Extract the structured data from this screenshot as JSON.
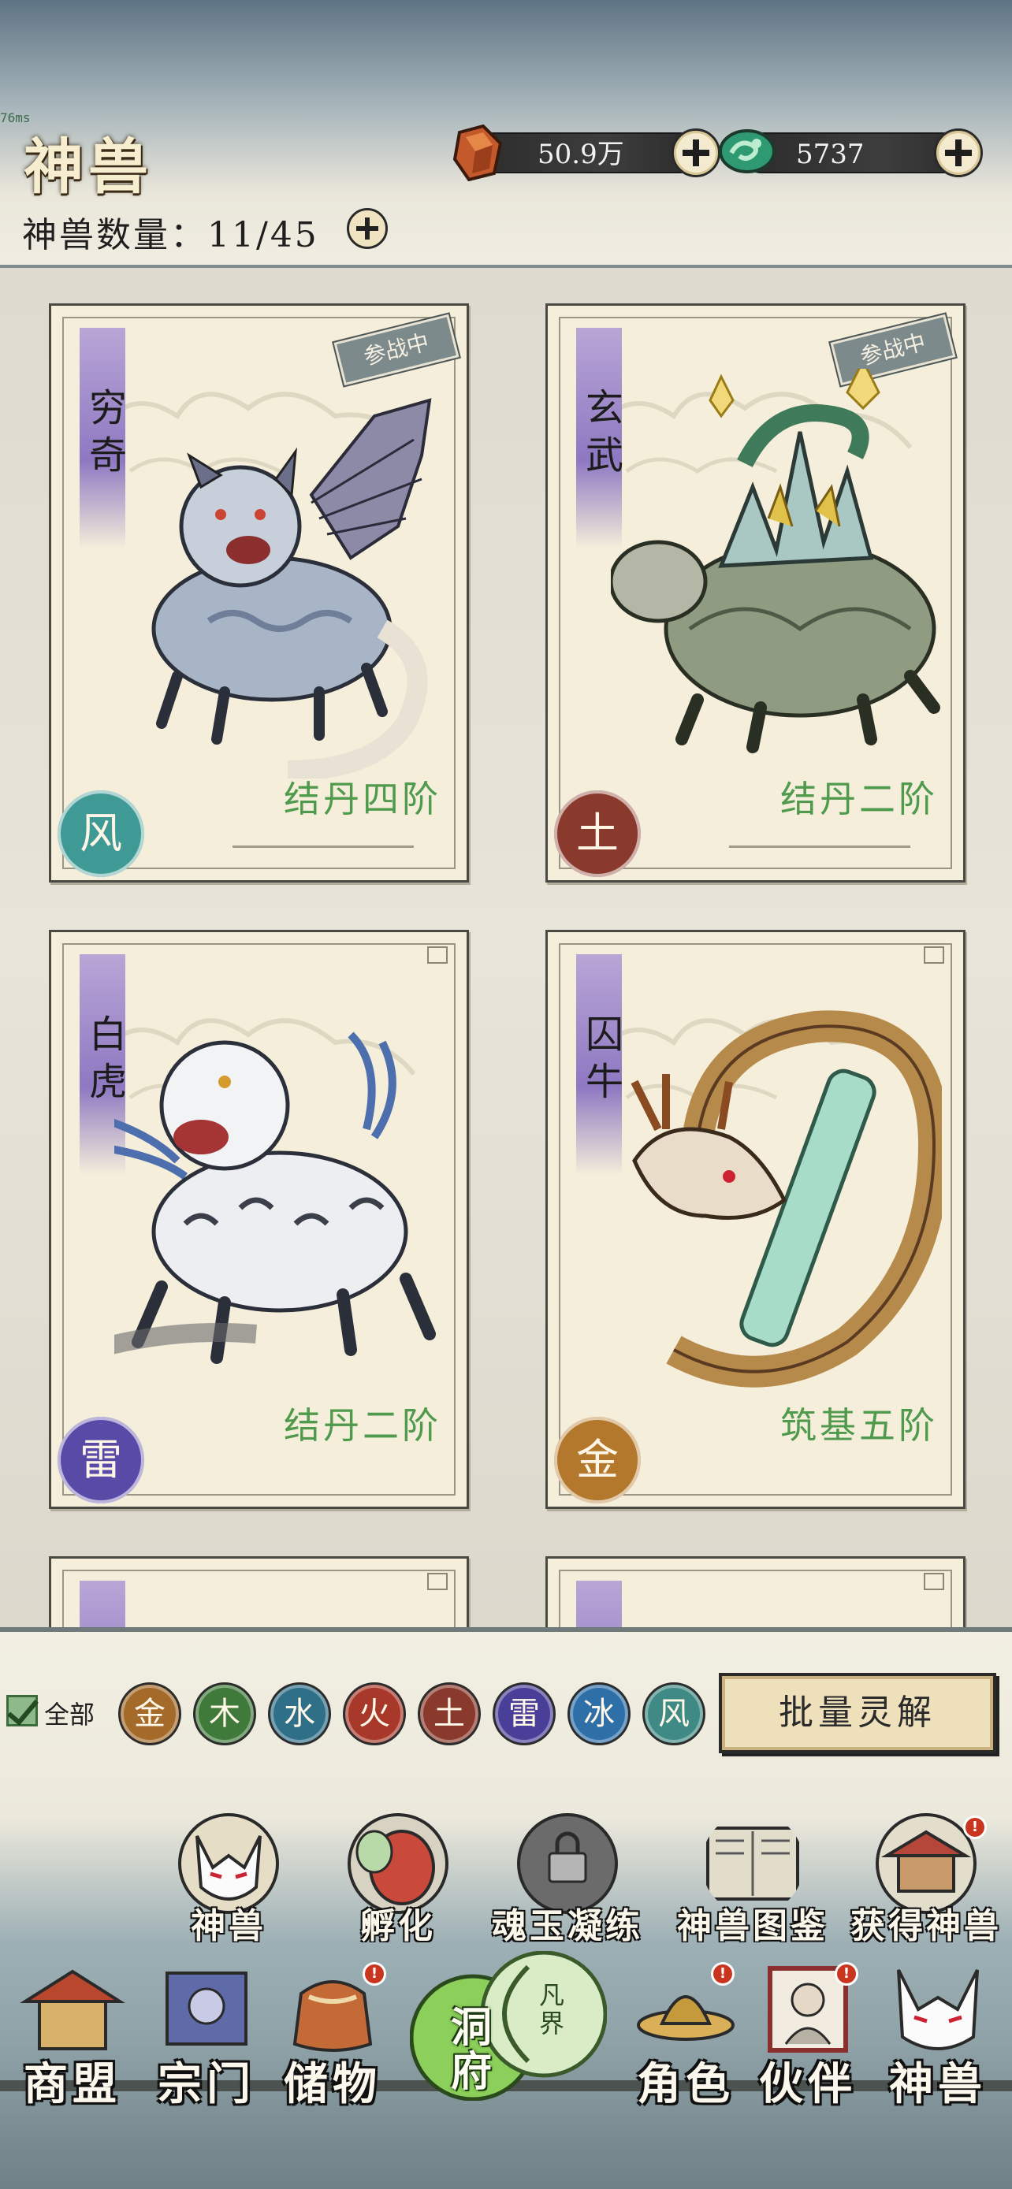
{
  "debug": {
    "fps_text": "76ms"
  },
  "header": {
    "title": "神兽",
    "currencies": [
      {
        "name": "spirit-stone",
        "icon": "red-stone-icon",
        "value": "50.9万"
      },
      {
        "name": "jade",
        "icon": "green-jade-icon",
        "value": "5737"
      }
    ],
    "beast_count_label": "神兽数量：",
    "beast_count_value": "11/45"
  },
  "cards": [
    {
      "name": "穷奇",
      "rank": "结丹四阶",
      "element": "风",
      "element_color": "#3f9a95",
      "status": "参战中",
      "ribbon_color": "#9a84cc"
    },
    {
      "name": "玄武",
      "rank": "结丹二阶",
      "element": "土",
      "element_color": "#8a3a2c",
      "status": "参战中",
      "ribbon_color": "#9a84cc"
    },
    {
      "name": "白虎",
      "rank": "结丹二阶",
      "element": "雷",
      "element_color": "#5a4aa8",
      "status": "",
      "ribbon_color": "#9a84cc"
    },
    {
      "name": "囚牛",
      "rank": "筑基五阶",
      "element": "金",
      "element_color": "#b3782b",
      "status": "",
      "ribbon_color": "#9a84cc"
    }
  ],
  "filter": {
    "all_label": "全部",
    "elements": [
      {
        "glyph": "金",
        "color": "#a36a2a"
      },
      {
        "glyph": "木",
        "color": "#3f7a3a"
      },
      {
        "glyph": "水",
        "color": "#2f6f88"
      },
      {
        "glyph": "火",
        "color": "#a7382a"
      },
      {
        "glyph": "土",
        "color": "#8a3a2c"
      },
      {
        "glyph": "雷",
        "color": "#4a3f98"
      },
      {
        "glyph": "冰",
        "color": "#2f6fa8"
      },
      {
        "glyph": "风",
        "color": "#3f8a85"
      }
    ],
    "batch_label": "批量灵解"
  },
  "sub_nav": [
    {
      "label": "神兽",
      "icon": "fox-mask-icon"
    },
    {
      "label": "孵化",
      "icon": "egg-icon"
    },
    {
      "label": "魂玉凝练",
      "icon": "locked-icon"
    },
    {
      "label": "神兽图鉴",
      "icon": "book-icon"
    },
    {
      "label": "获得神兽",
      "icon": "temple-icon"
    }
  ],
  "main_nav": [
    {
      "label": "商盟",
      "icon": "pavilion-icon",
      "badge": false
    },
    {
      "label": "宗门",
      "icon": "banner-icon",
      "badge": false
    },
    {
      "label": "储物",
      "icon": "bag-icon",
      "badge": true
    },
    {
      "label": "洞府",
      "icon": "cave-icon",
      "badge": false
    },
    {
      "label": "凡界",
      "icon": "world-icon",
      "badge": false
    },
    {
      "label": "角色",
      "icon": "hat-icon",
      "badge": true
    },
    {
      "label": "伙伴",
      "icon": "portrait-icon",
      "badge": true
    },
    {
      "label": "神兽",
      "icon": "fox-mask-icon",
      "badge": false
    }
  ],
  "badge_text": "!"
}
